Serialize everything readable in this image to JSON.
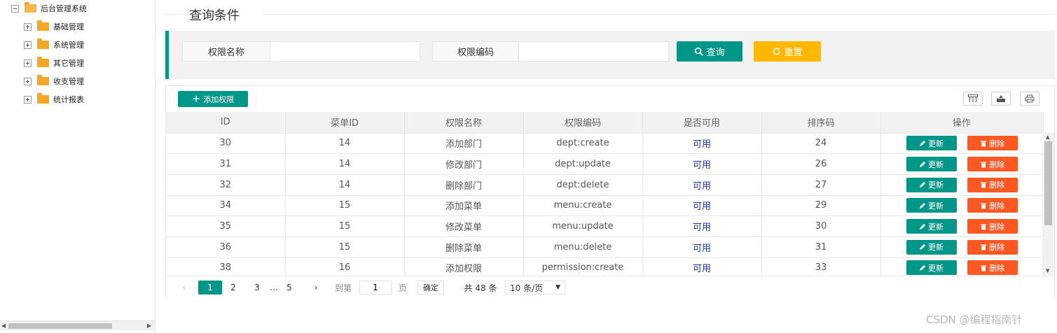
{
  "tree": {
    "root": "后台管理系统",
    "children": [
      "基础管理",
      "系统管理",
      "其它管理",
      "收支管理",
      "统计报表"
    ]
  },
  "query": {
    "title": "查询条件",
    "name_label": "权限名称",
    "name_value": "",
    "code_label": "权限编码",
    "code_value": "",
    "search_label": "查询",
    "reset_label": "重置"
  },
  "table": {
    "add_label": "添加权限",
    "headers": [
      "ID",
      "菜单ID",
      "权限名称",
      "权限编码",
      "是否可用",
      "排序码",
      "操作"
    ],
    "edit_label": "更新",
    "delete_label": "删除",
    "rows": [
      [
        "30",
        "14",
        "添加部门",
        "dept:create",
        "可用",
        "24"
      ],
      [
        "31",
        "14",
        "修改部门",
        "dept:update",
        "可用",
        "26"
      ],
      [
        "32",
        "14",
        "删除部门",
        "dept:delete",
        "可用",
        "27"
      ],
      [
        "34",
        "15",
        "添加菜单",
        "menu:create",
        "可用",
        "29"
      ],
      [
        "35",
        "15",
        "修改菜单",
        "menu:update",
        "可用",
        "30"
      ],
      [
        "36",
        "15",
        "删除菜单",
        "menu:delete",
        "可用",
        "31"
      ],
      [
        "38",
        "16",
        "添加权限",
        "permission:create",
        "可用",
        "33"
      ]
    ]
  },
  "pager": {
    "pages": [
      "1",
      "2",
      "3",
      "…",
      "5"
    ],
    "current": "1",
    "goto_prefix": "到第",
    "goto_value": "1",
    "goto_suffix": "页",
    "confirm": "确定",
    "total": "共 48 条",
    "page_size": "10 条/页"
  },
  "watermark": "CSDN @编程指南针",
  "colors": {
    "primary": "#009688",
    "warning": "#ffb800",
    "danger": "#ff5722",
    "available": "#1e2fbf"
  }
}
